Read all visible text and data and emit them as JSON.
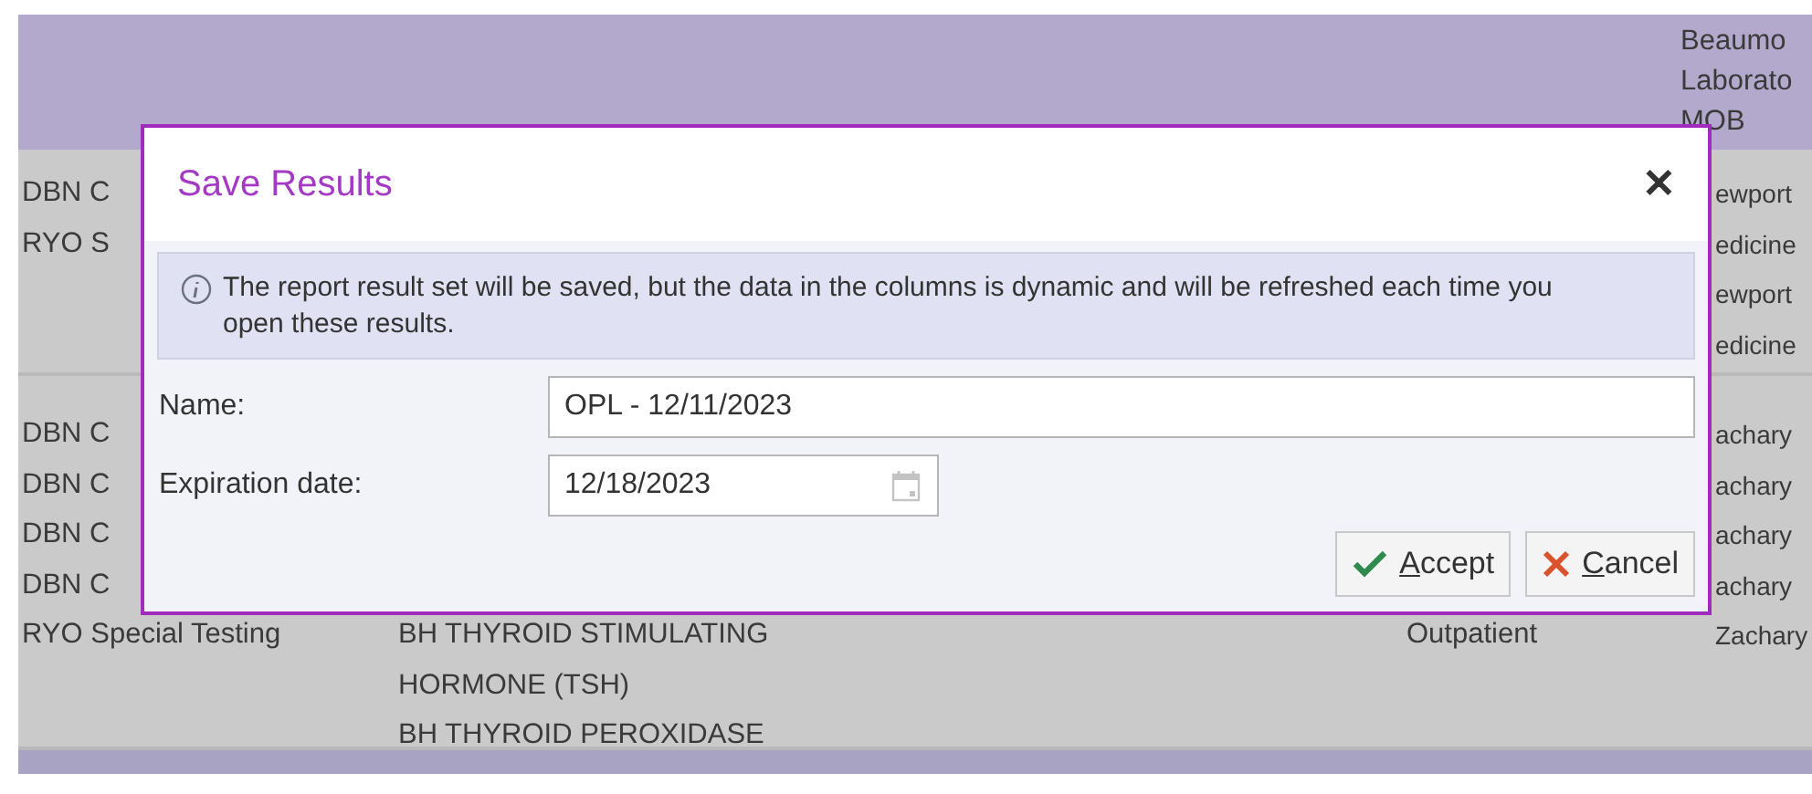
{
  "table": {
    "header": {
      "column_4": [
        "Beaumo",
        "Laborato",
        "MOB"
      ]
    },
    "rows": [
      {
        "column_1": [
          "DBN C",
          "RYO S"
        ],
        "column_2": [],
        "column_3": [],
        "column_4": [
          "ewport",
          "edicine",
          "ewport",
          "edicine"
        ]
      },
      {
        "column_1": [
          "DBN C",
          "DBN C",
          "DBN C",
          "DBN C",
          "RYO Special Testing"
        ],
        "column_2": [
          "BH THYROID STIMULATING",
          "HORMONE (TSH)",
          "BH THYROID PEROXIDASE"
        ],
        "column_3": [
          "Outpatient"
        ],
        "column_4": [
          "achary",
          "achary",
          "achary",
          "achary",
          "Zachary"
        ]
      }
    ]
  },
  "dialog": {
    "title": "Save Results",
    "close": "✕",
    "info": "The report result set will be saved, but the data in the columns is dynamic and will be refreshed each time you open these results.",
    "fields": [
      {
        "kind": "text",
        "label": "Name:",
        "value": "OPL - 12/11/2023"
      },
      {
        "kind": "date",
        "label": "Expiration date:",
        "value": "12/18/2023"
      }
    ],
    "buttons": [
      {
        "kind": "accept",
        "label": [
          {
            "text": "A",
            "underlined": true
          },
          {
            "text": "ccept",
            "underlined": false
          }
        ]
      },
      {
        "kind": "cancel",
        "label": [
          {
            "text": "C",
            "underlined": true
          },
          {
            "text": "ancel",
            "underlined": false
          }
        ]
      }
    ]
  }
}
